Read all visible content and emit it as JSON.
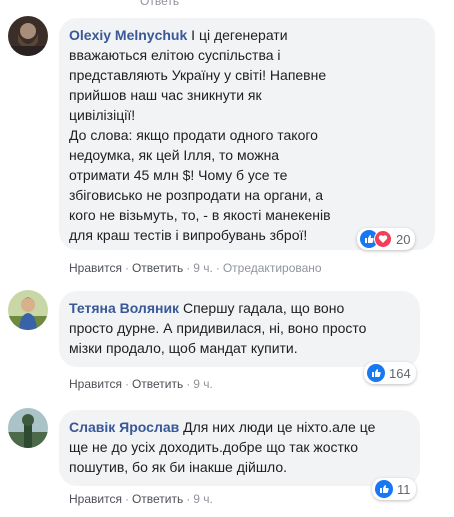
{
  "header_fragment": "Ответь",
  "comments": [
    {
      "author": "Olexiy Melnychuk",
      "lines": [
        "І ці дегенерати",
        "вважаються елітою суспільства і",
        "представляють Україну у світі! Напевне",
        "прийшов наш час зникнути як",
        "цивілізіції!",
        "До слова: якщо продати одного такого",
        "недоумка, як цей Ілля, то можна",
        "отримати 45 млн $! Чому б усе те",
        "збіговисько не розпродати на органи, а",
        "кого не візьмуть, то, - в якості манекенів",
        "для краш тестів і випробувань зброї!"
      ],
      "reaction_count": "20",
      "reactions": [
        "like-icon",
        "love-icon"
      ],
      "like_label": "Нравится",
      "reply_label": "Ответить",
      "time": "9 ч.",
      "edited": "Отредактировано"
    },
    {
      "author": "Тетяна Воляник",
      "lines": [
        "Спершу гадала, що воно",
        "просто дурне. А придивилася, ні, воно просто",
        "мізки продало, щоб мандат купити."
      ],
      "reaction_count": "164",
      "reactions": [
        "like-icon"
      ],
      "like_label": "Нравится",
      "reply_label": "Ответить",
      "time": "9 ч."
    },
    {
      "author": "Славік Ярослав",
      "lines": [
        "Для них люди це ніхто.але це",
        "ще не до усіх доходить.добре що так жостко",
        "пошутив, бо як би інакше дійшло."
      ],
      "reaction_count": "11",
      "reactions": [
        "like-icon"
      ],
      "like_label": "Нравится",
      "reply_label": "Ответить",
      "time": "9 ч."
    }
  ],
  "colors": {
    "author": "#385898",
    "bubble": "#f2f3f5",
    "meta": "#90949c",
    "like": "#1877f2",
    "love": "#f33e58"
  }
}
